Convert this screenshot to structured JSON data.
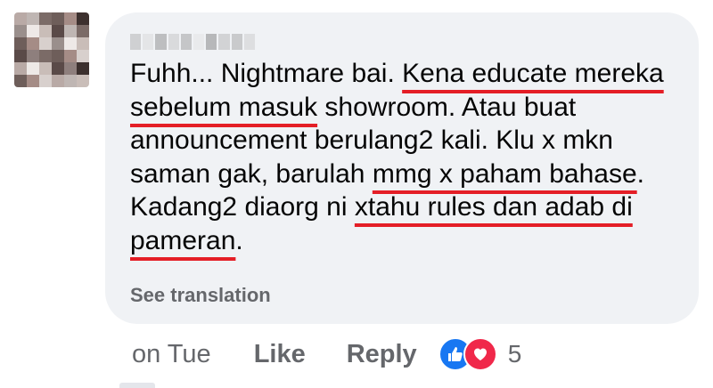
{
  "comment": {
    "segments": [
      {
        "text": "Fuhh... Nightmare bai. ",
        "underline": false
      },
      {
        "text": "Kena educate mereka sebelum masuk",
        "underline": true
      },
      {
        "text": " showroom. Atau buat announcement berulang2 kali. Klu x mkn saman gak, barulah ",
        "underline": false
      },
      {
        "text": "mmg x paham bahase",
        "underline": true
      },
      {
        "text": ". Kadang2 diaorg ni ",
        "underline": false
      },
      {
        "text": "xtahu rules dan adab di pameran",
        "underline": true
      },
      {
        "text": ".",
        "underline": false
      }
    ],
    "see_translation": "See translation"
  },
  "actions": {
    "time": "on Tue",
    "like": "Like",
    "reply": "Reply",
    "reaction_count": "5",
    "reaction_icons": [
      "like-icon",
      "love-icon"
    ]
  },
  "colors": {
    "bubble": "#f0f2f5",
    "text": "#050505",
    "meta": "#65676b",
    "underline": "#e41e26",
    "like": "#1877f2",
    "love": "#f0284a"
  }
}
